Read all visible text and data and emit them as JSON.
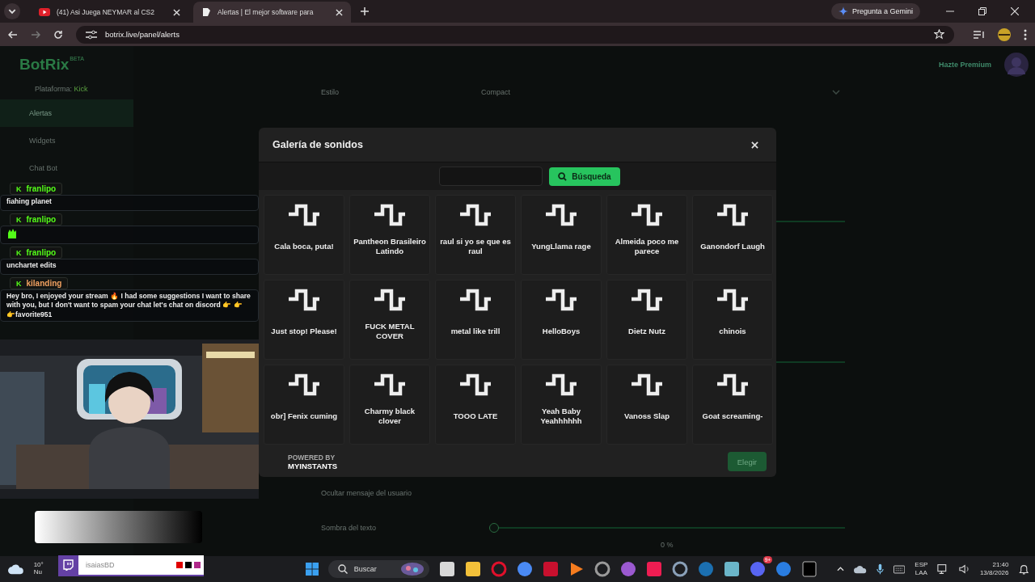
{
  "browser": {
    "tabs": [
      {
        "title": "(41) Asi Juega NEYMAR al CS2",
        "selected": false
      },
      {
        "title": "Alertas | El mejor software para",
        "selected": true
      }
    ],
    "address": "botrix.live/panel/alerts",
    "gemini_button": "Pregunta a Gemini"
  },
  "page": {
    "logo": "BotRix",
    "logo_badge": "BETA",
    "platform_label": "Plataforma:",
    "platform": "Kick",
    "nav": [
      {
        "label": "Alertas",
        "selected": true
      },
      {
        "label": "Widgets",
        "selected": false
      },
      {
        "label": "Chat Bot",
        "selected": false
      }
    ],
    "premium": "Hazte Premium",
    "style_label": "Estilo",
    "style_value": "Compact",
    "hide_label": "Ocultar mensaje del usuario",
    "shadow_label": "Sombra del texto",
    "shadow_slider": {
      "level": 0
    },
    "shadow_reading": "0 %"
  },
  "modal": {
    "title": "Galería de sonidos",
    "search_button": "Búsqueda",
    "sounds": [
      "Cala boca, puta!",
      "Pantheon Brasileiro Latindo",
      "raul si yo se que es raul",
      "YungLlama rage",
      "Almeida poco me parece",
      "Ganondorf Laugh",
      "Just stop! Please!",
      "FUCK METAL COVER",
      "metal like trill",
      "HelloBoys",
      "Dietz Nutz",
      "chinois",
      "obr] Fenix cuming",
      "Charmy black clover",
      "TOOO LATE",
      "Yeah Baby Yeahhhhhh",
      "Vanoss Slap",
      "Goat screaming-"
    ],
    "powered_by": "POWERED BY",
    "provider": "MYINSTANTS",
    "choose_button": {
      "label": "Elegir",
      "disabled": true
    }
  },
  "stream_overlay": {
    "chat": [
      {
        "badge": "K",
        "user": "franlipo",
        "color": "#53fc18",
        "kind": "text",
        "message": "fiahing planet"
      },
      {
        "badge": "K",
        "user": "franlipo",
        "color": "#53fc18",
        "kind": "emote"
      },
      {
        "badge": "K",
        "user": "franlipo",
        "color": "#53fc18",
        "kind": "text",
        "message": "unchartet edits"
      },
      {
        "badge": "K",
        "user": "kilanding",
        "color": "#f0a060",
        "kind": "text",
        "message": "Hey bro, I enjoyed your stream 🔥 I had some suggestions I want to share with you, but I don't want to spam your chat let's chat on discord 👉 👉 👉favorite951"
      }
    ],
    "channel": "isaiasBD",
    "swatches": [
      {
        "color": "#e00000"
      },
      {
        "color": "#000000"
      },
      {
        "color": "#b0288a"
      }
    ]
  },
  "taskbar": {
    "weather_temp": "10°",
    "weather_text": "Nu",
    "search_placeholder": "Buscar",
    "discord_badge": "9+",
    "language": "ESP",
    "layout": "LAA",
    "time": "21:40",
    "date": "13/8/2026"
  }
}
